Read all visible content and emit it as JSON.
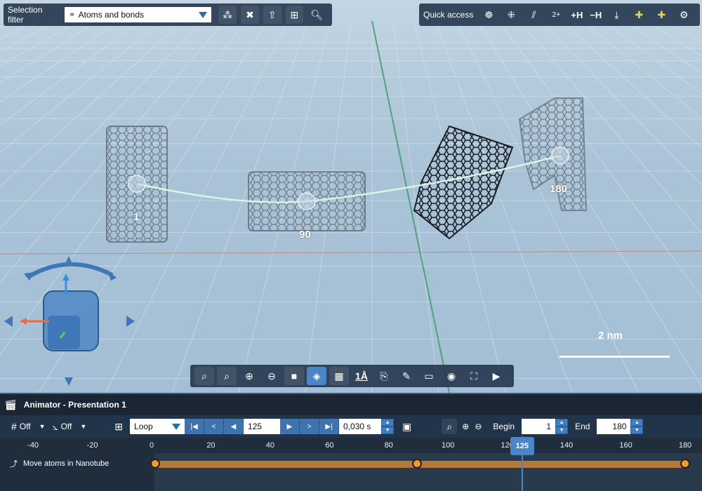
{
  "selection_filter": {
    "label": "Selection filter",
    "value": "Atoms and bonds"
  },
  "quick_access": {
    "label": "Quick access",
    "plus_h": "+H",
    "minus_h": "−H",
    "charge": "2+"
  },
  "frames": [
    {
      "label": "1"
    },
    {
      "label": "90"
    },
    {
      "label": "180"
    }
  ],
  "scale": {
    "label": "2 nm"
  },
  "bottom_toolbar": {
    "angstrom": "1Å"
  },
  "animator": {
    "title": "Animator - Presentation 1",
    "snap1": "Off",
    "snap2": "Off",
    "loop_mode": "Loop",
    "current_frame": "125",
    "frame_time": "0,030 s",
    "begin_label": "Begin",
    "begin_value": "1",
    "end_label": "End",
    "end_value": "180",
    "ruler": [
      "-40",
      "-20",
      "0",
      "20",
      "40",
      "60",
      "80",
      "100",
      "120",
      "140",
      "160",
      "180"
    ],
    "playhead": "125",
    "track_name": "Move atoms in Nanotube",
    "keyframes": [
      1,
      90,
      180
    ]
  },
  "colors": {
    "accent": "#4a86c5",
    "keyframe": "#f39a28",
    "track": "#b57a3a"
  }
}
